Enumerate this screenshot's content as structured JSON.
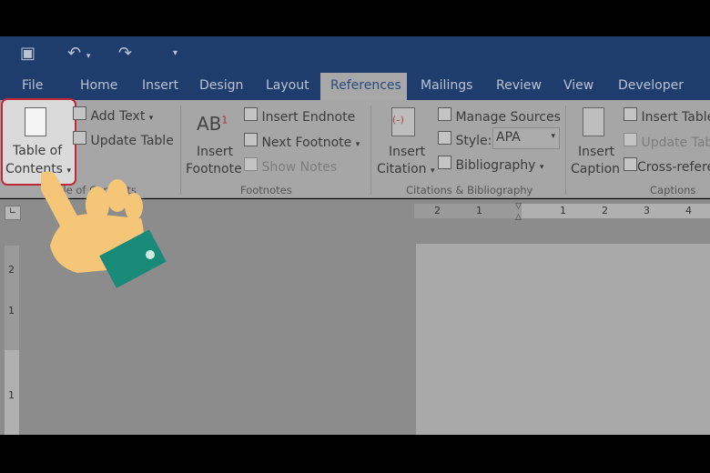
{
  "quick_access": {
    "save_icon": "save-icon",
    "undo_icon": "undo-icon",
    "redo_icon": "redo-icon",
    "customize_icon": "customize-icon"
  },
  "tabs": [
    "File",
    "Home",
    "Insert",
    "Design",
    "Layout",
    "References",
    "Mailings",
    "Review",
    "View",
    "Developer"
  ],
  "active_tab": "References",
  "toc_group": {
    "toc_button": "Table of",
    "toc_button2": "Contents",
    "add_text": "Add Text",
    "update_table": "Update Table",
    "label": "Table of Contents"
  },
  "footnotes_group": {
    "insert_footnote": "Insert",
    "insert_footnote2": "Footnote",
    "ab_glyph": "AB",
    "sup": "1",
    "insert_endnote": "Insert Endnote",
    "next_footnote": "Next Footnote",
    "show_notes": "Show Notes",
    "label": "Footnotes"
  },
  "citations_group": {
    "insert_citation": "Insert",
    "insert_citation2": "Citation",
    "manage_sources": "Manage Sources",
    "style_label": "Style:",
    "style_value": "APA",
    "bibliography": "Bibliography",
    "label": "Citations & Bibliography"
  },
  "captions_group": {
    "insert_caption": "Insert",
    "insert_caption2": "Caption",
    "insert_table": "Insert Table",
    "update_table": "Update Tab",
    "cross_reference": "Cross-refere",
    "label": "Captions"
  },
  "ruler": {
    "marks": [
      "2",
      "1",
      "1",
      "2",
      "3",
      "4"
    ],
    "vmarks": [
      "2",
      "1",
      "1"
    ]
  },
  "colors": {
    "title_bar": "#1e3d6d",
    "highlight": "#c0283a",
    "hand": "#f6c678",
    "cuff": "#1a8a78"
  }
}
